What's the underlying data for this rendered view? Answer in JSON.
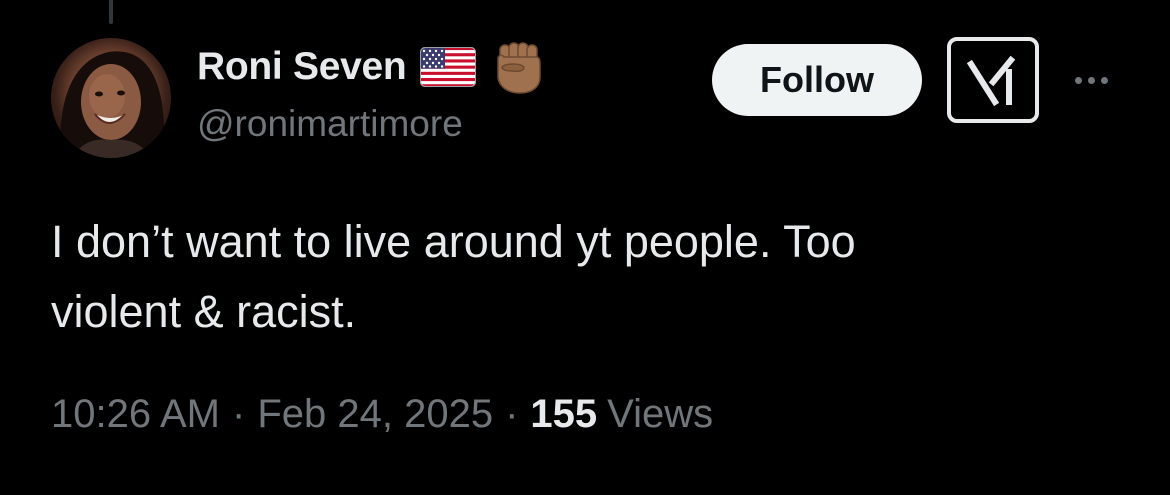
{
  "author": {
    "display_name": "Roni Seven",
    "handle": "@ronimartimore",
    "badges": [
      "us-flag-icon",
      "raised-fist-icon"
    ]
  },
  "actions": {
    "follow_label": "Follow",
    "grok_icon": "grok-icon",
    "more_icon": "more-options-icon"
  },
  "tweet": {
    "text": "I don’t want to live around yt people. Too\nviolent & racist."
  },
  "meta": {
    "time": "10:26 AM",
    "separator": "·",
    "date": "Feb 24, 2025",
    "views_count": "155",
    "views_label": "Views"
  },
  "colors": {
    "background": "#000000",
    "primary_text": "#e7e9ea",
    "secondary_text": "#71767b",
    "follow_button_bg": "#eff3f4"
  }
}
